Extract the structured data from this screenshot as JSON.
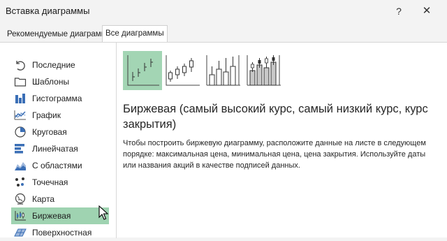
{
  "window": {
    "title": "Вставка диаграммы",
    "help_glyph": "?",
    "close_glyph": "✕"
  },
  "tabs": [
    {
      "label": "Рекомендуемые диаграммы",
      "selected": false
    },
    {
      "label": "Все диаграммы",
      "selected": true
    }
  ],
  "sidebar": {
    "items": [
      {
        "label": "Последние",
        "icon": "recent-icon"
      },
      {
        "label": "Шаблоны",
        "icon": "templates-folder-icon"
      },
      {
        "label": "Гистограмма",
        "icon": "column-chart-icon"
      },
      {
        "label": "График",
        "icon": "line-chart-icon"
      },
      {
        "label": "Круговая",
        "icon": "pie-chart-icon"
      },
      {
        "label": "Линейчатая",
        "icon": "bar-chart-icon"
      },
      {
        "label": "С областями",
        "icon": "area-chart-icon"
      },
      {
        "label": "Точечная",
        "icon": "scatter-chart-icon"
      },
      {
        "label": "Карта",
        "icon": "map-chart-icon"
      },
      {
        "label": "Биржевая",
        "icon": "stock-chart-icon",
        "selected": true
      },
      {
        "label": "Поверхностная",
        "icon": "surface-chart-icon"
      }
    ],
    "selected_color": "#9fd3b1"
  },
  "subtypes": [
    {
      "name": "high-low-close",
      "selected": true
    },
    {
      "name": "open-high-low-close",
      "selected": false
    },
    {
      "name": "volume-high-low-close",
      "selected": false
    },
    {
      "name": "volume-open-high-low-close",
      "selected": false
    }
  ],
  "main": {
    "title": "Биржевая (самый высокий курс, самый низкий курс, курс закрытия)",
    "description": "Чтобы построить биржевую диаграмму, расположите данные на листе в следующем порядке: максимальная цена, минимальная цена, цена закрытия. Используйте даты или названия акций в качестве подписей данных."
  }
}
